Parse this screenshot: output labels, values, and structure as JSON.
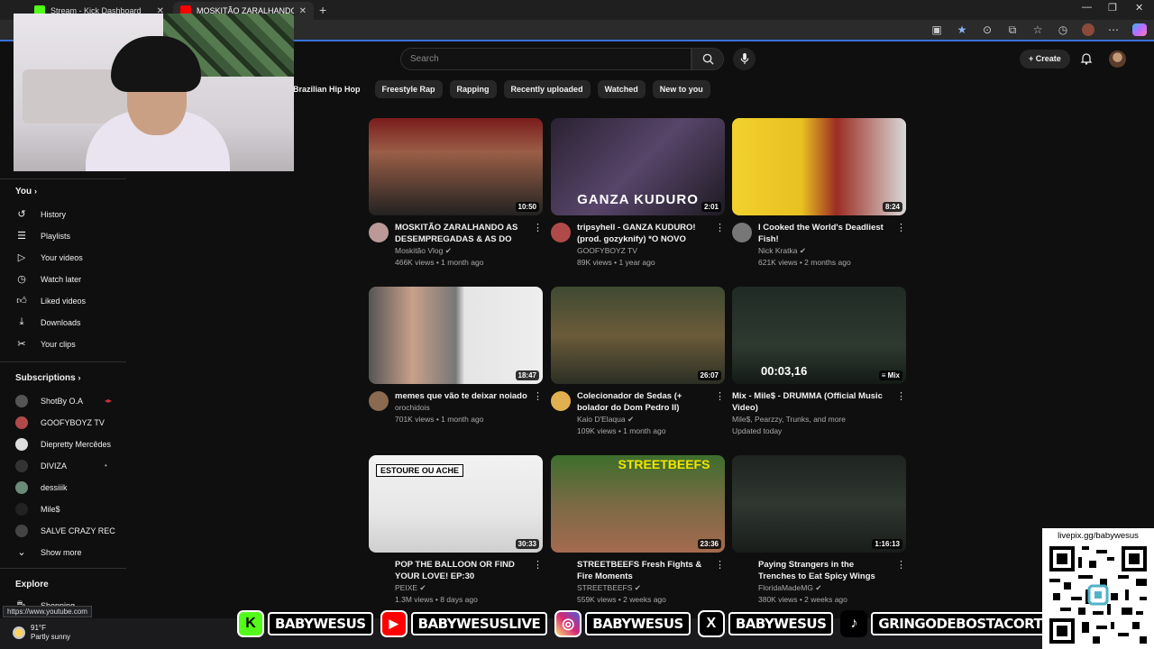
{
  "browser": {
    "tabs": [
      {
        "title": "Stream - Kick Dashboard",
        "favicon_color": "#53fc18"
      },
      {
        "title": "MOSKITÃO ZARALHANDO AS MU",
        "favicon_color": "#ff0000"
      }
    ],
    "new_tab_symbol": "+",
    "window_controls": [
      "—",
      "❐",
      "✕"
    ]
  },
  "header": {
    "search_placeholder": "Search",
    "create_label": "Create"
  },
  "chips": [
    "Brazilian Hip Hop",
    "Freestyle Rap",
    "Rapping",
    "Recently uploaded",
    "Watched",
    "New to you"
  ],
  "sidebar": {
    "you_title": "You",
    "you_items": [
      {
        "label": "History",
        "icon": "history-icon"
      },
      {
        "label": "Playlists",
        "icon": "playlists-icon"
      },
      {
        "label": "Your videos",
        "icon": "your-videos-icon"
      },
      {
        "label": "Watch later",
        "icon": "watch-later-icon"
      },
      {
        "label": "Liked videos",
        "icon": "like-icon"
      },
      {
        "label": "Downloads",
        "icon": "download-icon"
      },
      {
        "label": "Your clips",
        "icon": "scissors-icon"
      }
    ],
    "subscriptions_title": "Subscriptions",
    "subscriptions": [
      {
        "label": "ShotBy O.A",
        "color": "#555555"
      },
      {
        "label": "GOOFYBOYZ TV",
        "color": "#b04a4a"
      },
      {
        "label": "Diepretty Mercêdes",
        "color": "#dddddd"
      },
      {
        "label": "DIVIZA",
        "color": "#333333"
      },
      {
        "label": "dessiiik",
        "color": "#6a8a7a"
      },
      {
        "label": "Mile$",
        "color": "#222222"
      },
      {
        "label": "SALVE CRAZY REC",
        "color": "#444444"
      }
    ],
    "show_more": "Show more",
    "explore_title": "Explore",
    "explore_items": [
      "Shopping"
    ]
  },
  "videos": [
    {
      "title": "MOSKITÃO ZARALHANDO AS DESEMPREGADAS & AS DO JOB ...",
      "channel": "Moskitão Vlog",
      "verified": true,
      "stats": "466K views • 1 month ago",
      "duration": "10:50",
      "avatar_color": "#b99",
      "thumb_bg": "linear-gradient(180deg,#7a1c1c 0%,#9a5e46 35%,#222 100%)"
    },
    {
      "title": "tripsyhell - GANZA KUDURO! (prod. gozyknify) *O NOVO SABO...",
      "channel": "GOOFYBOYZ TV",
      "verified": false,
      "stats": "89K views • 1 year ago",
      "duration": "2:01",
      "avatar_color": "#b04a4a",
      "thumb_bg": "linear-gradient(135deg,#2a2232 0%,#58456a 50%,#1e1a22 100%)",
      "overlay_text": "GANZA KUDURO"
    },
    {
      "title": "I Cooked the World's Deadliest Fish!",
      "channel": "Nick Kratka",
      "verified": true,
      "stats": "621K views • 2 months ago",
      "duration": "8:24",
      "avatar_color": "#777",
      "thumb_bg": "linear-gradient(90deg,#f2d12e 0%,#e8c021 40%,#9b2d23 60%,#d9d9d9 100%)"
    },
    {
      "title": "memes que vão te deixar noiado",
      "channel": "orochidois",
      "verified": false,
      "stats": "701K views • 1 month ago",
      "duration": "18:47",
      "avatar_color": "#8a6a50",
      "thumb_bg": "linear-gradient(90deg,#555 0%,#c9a08a 25%,#777 50%,#e5e5e5 55%,#eee 100%)"
    },
    {
      "title": "Colecionador de Sedas (+ bolador do Dom Pedro II)",
      "channel": "Kaio D'Elaqua",
      "verified": true,
      "stats": "109K views • 1 month ago",
      "duration": "26:07",
      "avatar_color": "#e0b050",
      "thumb_bg": "linear-gradient(180deg,#3f4a32 0%,#6b5b3a 50%,#2b2f24 100%)"
    },
    {
      "title": "Mix - Mile$ - DRUMMA (Official Music Video)",
      "channel": "Mile$, Pearzzy, Trunks, and more",
      "verified": false,
      "stats": "Updated today",
      "duration": "Mix",
      "avatar_color": "",
      "thumb_bg": "linear-gradient(180deg,#1f2a24 0%,#2e3a30 60%,#141a16 100%)",
      "overlay_text": "00:03,16"
    },
    {
      "title": "POP THE BALLOON OR FIND YOUR LOVE! EP:30",
      "channel": "PEIXE",
      "verified": true,
      "stats": "1.3M views • 8 days ago",
      "duration": "30:33",
      "avatar_color": "",
      "thumb_bg": "linear-gradient(180deg,#f2f2f2 0%,#e6e6e6 60%,#cfcfcf 100%)",
      "overlay_text": "ESTOURE OU ACHE"
    },
    {
      "title": "STREETBEEFS Fresh Fights & Fire Moments",
      "channel": "STREETBEEFS",
      "verified": true,
      "stats": "559K views • 2 weeks ago",
      "duration": "23:36",
      "avatar_color": "",
      "thumb_bg": "linear-gradient(180deg,#3d6e2c 0%,#7a6a44 50%,#a56a4f 100%)",
      "overlay_text": "STREETBEEFS"
    },
    {
      "title": "Paying Strangers in the Trenches to Eat Spicy Wings",
      "channel": "FloridaMadeMG",
      "verified": true,
      "stats": "380K views • 2 weeks ago",
      "duration": "1:16:13",
      "avatar_color": "",
      "thumb_bg": "linear-gradient(180deg,#1e2420 0%,#2f3730 50%,#191d1a 100%)"
    }
  ],
  "status_link": "https://www.youtube.com",
  "weather": {
    "temp": "91°F",
    "desc": "Partly sunny"
  },
  "socials": [
    {
      "handle": "BABYWESUS",
      "icon": "kick-icon",
      "logo_text": "K",
      "color": "#53fc18"
    },
    {
      "handle": "BABYWESUSLIVE",
      "icon": "youtube-icon",
      "logo_text": "▶",
      "color": "#ff0000"
    },
    {
      "handle": "BABYWESUS",
      "icon": "instagram-icon",
      "logo_text": "◎",
      "color": "#d6249f"
    },
    {
      "handle": "BABYWESUS",
      "icon": "x-icon",
      "logo_text": "X",
      "color": "#000000"
    },
    {
      "handle": "GRINGODEBOSTACORTES",
      "icon": "tiktok-icon",
      "logo_text": "♪",
      "color": "#000000"
    }
  ],
  "qr_label": "livepix.gg/babywesus"
}
